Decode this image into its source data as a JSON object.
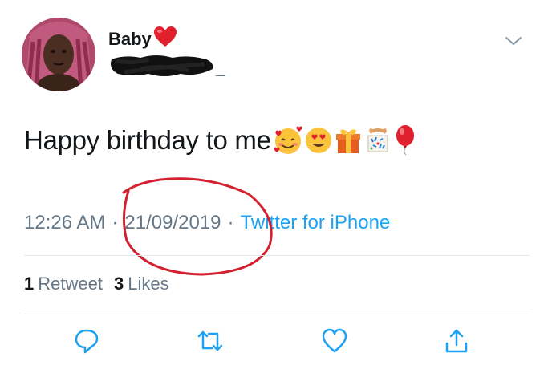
{
  "tweet": {
    "author": {
      "display_name": "Baby",
      "name_emoji": "heart-emoji",
      "handle": "_"
    },
    "text": "Happy birthday to me",
    "text_emojis": [
      "smiling-face-with-hearts",
      "heart-eyes",
      "wrapped-gift",
      "confetti-ball",
      "red-balloon"
    ],
    "time": "12:26 AM",
    "date": "21/09/2019",
    "separator": "·",
    "source": "Twitter for iPhone",
    "stats": {
      "retweets_count": "1",
      "retweets_label": "Retweet",
      "likes_count": "3",
      "likes_label": "Likes"
    },
    "actions": [
      "reply-icon",
      "retweet-icon",
      "like-icon",
      "share-icon"
    ]
  },
  "colors": {
    "link": "#1da1f2",
    "muted": "#657786",
    "divider": "#e1e8ed",
    "annotation": "#d4212f"
  }
}
